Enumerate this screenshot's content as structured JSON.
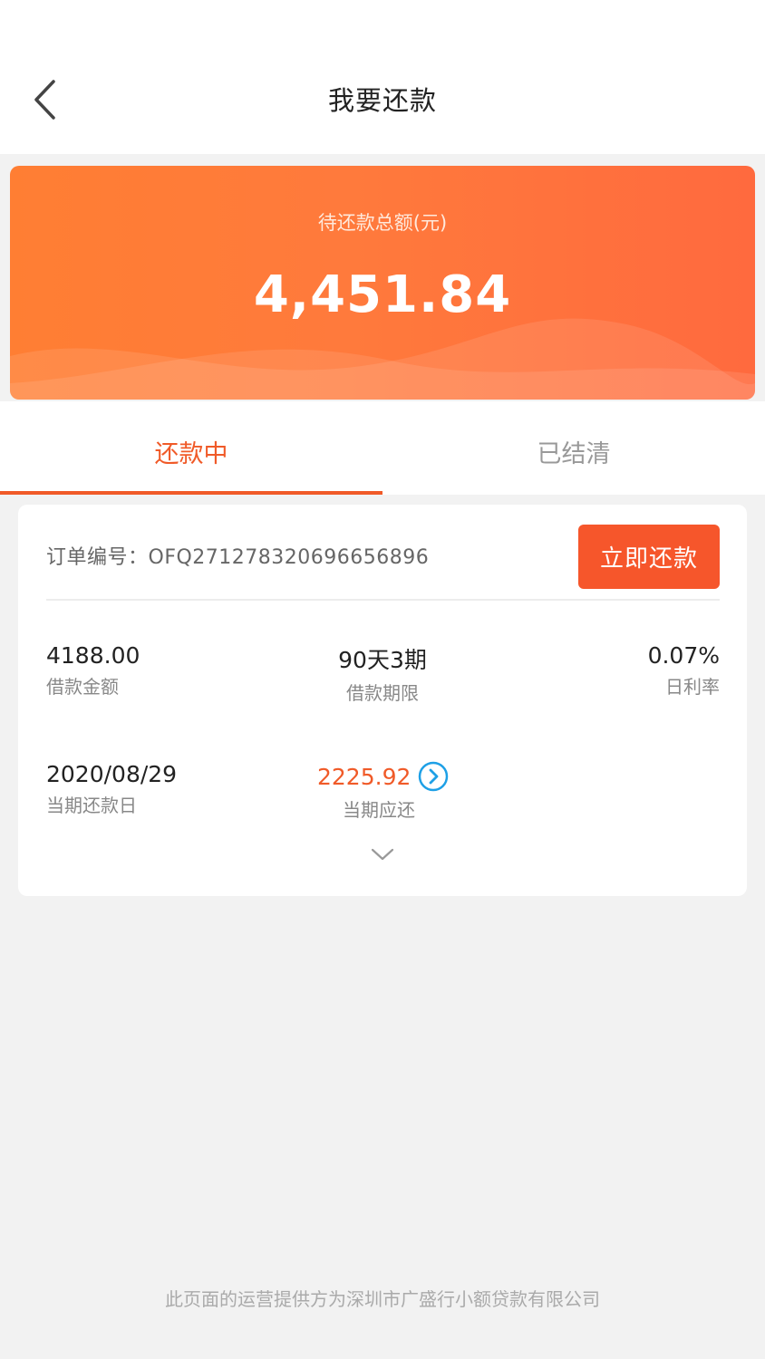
{
  "header": {
    "title": "我要还款",
    "back_icon": "chevron-left-icon"
  },
  "summary": {
    "label": "待还款总额(元)",
    "amount": "4,451.84"
  },
  "tabs": [
    {
      "label": "还款中",
      "active": true
    },
    {
      "label": "已结清",
      "active": false
    }
  ],
  "order": {
    "order_no_label": "订单编号：",
    "order_no": "OFQ271278320696656896",
    "pay_button": "立即还款",
    "loan_amount": {
      "value": "4188.00",
      "label": "借款金额"
    },
    "loan_term": {
      "value": "90天3期",
      "label": "借款期限"
    },
    "daily_rate": {
      "value": "0.07%",
      "label": "日利率"
    },
    "due_date": {
      "value": "2020/08/29",
      "label": "当期还款日"
    },
    "due_amount": {
      "value": "2225.92",
      "label": "当期应还"
    }
  },
  "footer": {
    "text": "此页面的运营提供方为深圳市广盛行小额贷款有限公司"
  },
  "colors": {
    "accent": "#f05a28",
    "button": "#f6562b",
    "card_gradient_start": "#ff7e33",
    "card_gradient_end": "#ff6a3e",
    "link_blue": "#1ea0e6"
  }
}
